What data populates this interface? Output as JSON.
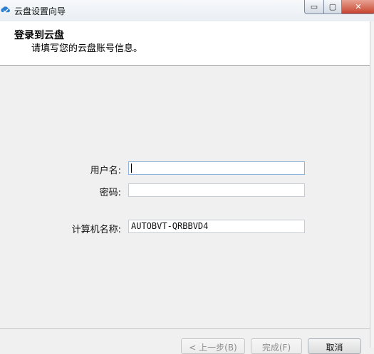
{
  "window": {
    "title": "云盘设置向导",
    "controls": {
      "minimize": "▭",
      "maximize": "▢",
      "close": "✕"
    }
  },
  "header": {
    "title": "登录到云盘",
    "subtitle": "请填写您的云盘账号信息。"
  },
  "form": {
    "username": {
      "label": "用户名:",
      "value": ""
    },
    "password": {
      "label": "密码:",
      "value": ""
    },
    "computer_name": {
      "label": "计算机名称:",
      "value": "AUTOBVT-QRBBVD4"
    }
  },
  "buttons": {
    "back": "< 上一步(B)",
    "finish": "完成(F)",
    "cancel": "取消"
  },
  "colors": {
    "header_bg": "#ffffff",
    "body_bg": "#f0f0f0",
    "close_button": "#c7442f",
    "focus_border": "#8fb4d8"
  }
}
